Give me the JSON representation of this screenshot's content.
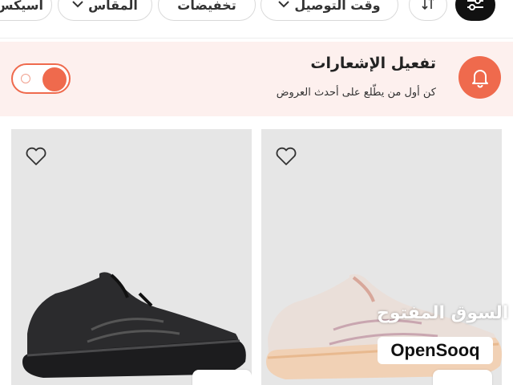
{
  "filters": {
    "more_label": "أسيكس",
    "size_label": "المقاس",
    "discounts_label": "تخفيضات",
    "delivery_time_label": "وقت التوصيل",
    "sort_icon": "sort-arrows-icon",
    "filter_icon": "filter-sliders-icon"
  },
  "notification": {
    "title": "تفعيل الإشعارات",
    "subtitle": "كن أول من يطّلع على أحدث العروض",
    "toggle_state": "on",
    "accent_color": "#ef6a4d",
    "background_color": "#fdf0ee"
  },
  "products": [
    {
      "id": "left",
      "color": "black",
      "favorite": false
    },
    {
      "id": "right",
      "color": "pale pink",
      "favorite": false
    }
  ],
  "watermark": {
    "arabic": "السوق المفتوح",
    "brand": "OpenSooq"
  }
}
